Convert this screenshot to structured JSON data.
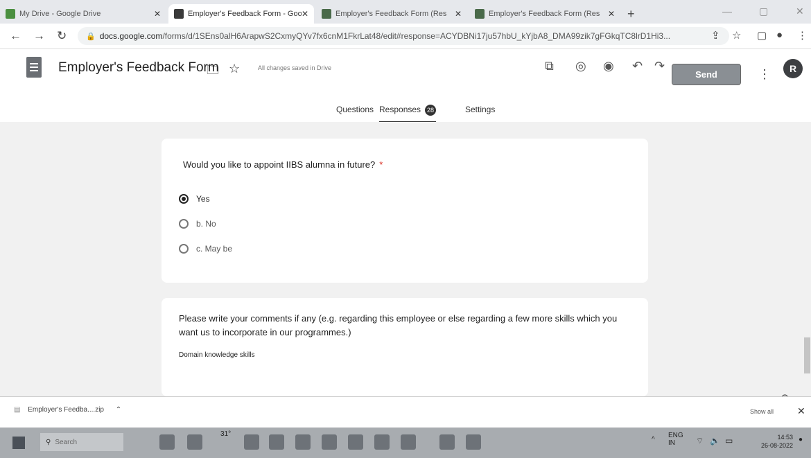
{
  "browser": {
    "tabs": [
      {
        "label": "My Drive - Google Drive",
        "active": false,
        "icon": "google-drive-icon",
        "color": "#4a8f3f"
      },
      {
        "label": "Employer's Feedback Form - Goo",
        "active": true,
        "icon": "google-forms-icon",
        "color": "#673ab7"
      },
      {
        "label": "Employer's Feedback Form (Res",
        "active": false,
        "icon": "google-sheets-icon",
        "color": "#188038"
      },
      {
        "label": "Employer's Feedback Form (Res",
        "active": false,
        "icon": "google-sheets-icon",
        "color": "#188038"
      }
    ],
    "new_tab_symbol": "+",
    "address": {
      "host": "docs.google.com",
      "path": "/forms/d/1SEns0alH6ArapwS2CxmyQYv7fx6cnM1FkrLat48/edit#response=ACYDBNi17ju57hbU_kYjbA8_DMA99zik7gFGkqTC8lrD1Hi3..."
    }
  },
  "app": {
    "title": "Employer's Feedback Form",
    "save_status": "All changes saved in Drive",
    "send_label": "Send",
    "avatar_letter": "R",
    "accent_color": "#8a8f94"
  },
  "subtabs": {
    "questions": "Questions",
    "responses": "Responses",
    "responses_count": "28",
    "settings": "Settings"
  },
  "question1": {
    "text": "Would you like to appoint  IIBS alumna  in future?",
    "required_mark": "*",
    "options": [
      {
        "label": "Yes",
        "selected": true
      },
      {
        "label": "b. No",
        "selected": false
      },
      {
        "label": "c. May be",
        "selected": false
      }
    ]
  },
  "question2": {
    "text": "Please write your comments if any (e.g. regarding this employee or else regarding a few more skills which you want us to incorporate in our programmes.)",
    "answer": "Domain knowledge skills"
  },
  "downloads": {
    "file_name": "Employer's Feedba....zip",
    "show_all": "Show all"
  },
  "taskbar": {
    "search_placeholder": "Search",
    "weather": "31°",
    "lang_primary": "ENG",
    "lang_secondary": "IN",
    "time": "14:53",
    "date": "26-08-2022"
  }
}
